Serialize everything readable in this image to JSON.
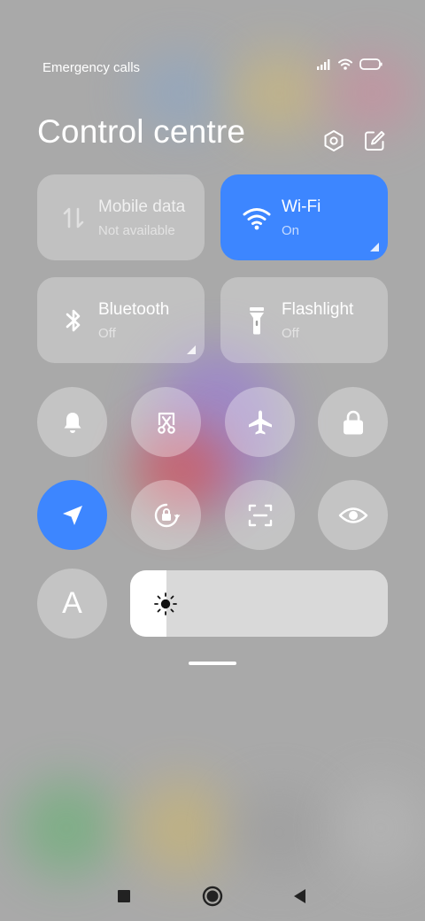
{
  "status": {
    "carrier_text": "Emergency calls"
  },
  "header": {
    "title": "Control centre",
    "settings_icon": "settings-hex-icon",
    "edit_icon": "edit-icon"
  },
  "tiles": [
    {
      "label": "Mobile data",
      "sub": "Not available",
      "icon": "mobile-data-icon",
      "active": false,
      "disabled": true
    },
    {
      "label": "Wi-Fi",
      "sub": "On",
      "icon": "wifi-icon",
      "active": true
    },
    {
      "label": "Bluetooth",
      "sub": "Off",
      "icon": "bluetooth-icon",
      "active": false
    },
    {
      "label": "Flashlight",
      "sub": "Off",
      "icon": "flashlight-icon",
      "active": false
    }
  ],
  "toggles": [
    {
      "icon": "bell-icon",
      "active": false
    },
    {
      "icon": "screenshot-icon",
      "active": false
    },
    {
      "icon": "airplane-icon",
      "active": false
    },
    {
      "icon": "lock-icon",
      "active": false
    },
    {
      "icon": "location-icon",
      "active": true
    },
    {
      "icon": "auto-rotate-icon",
      "active": false
    },
    {
      "icon": "scanner-icon",
      "active": false
    },
    {
      "icon": "eye-icon",
      "active": false
    }
  ],
  "auto_brightness": {
    "glyph": "A"
  },
  "brightness": {
    "level": 0.14
  },
  "colors": {
    "accent": "#3d86ff",
    "background": "#a9a9a9"
  }
}
